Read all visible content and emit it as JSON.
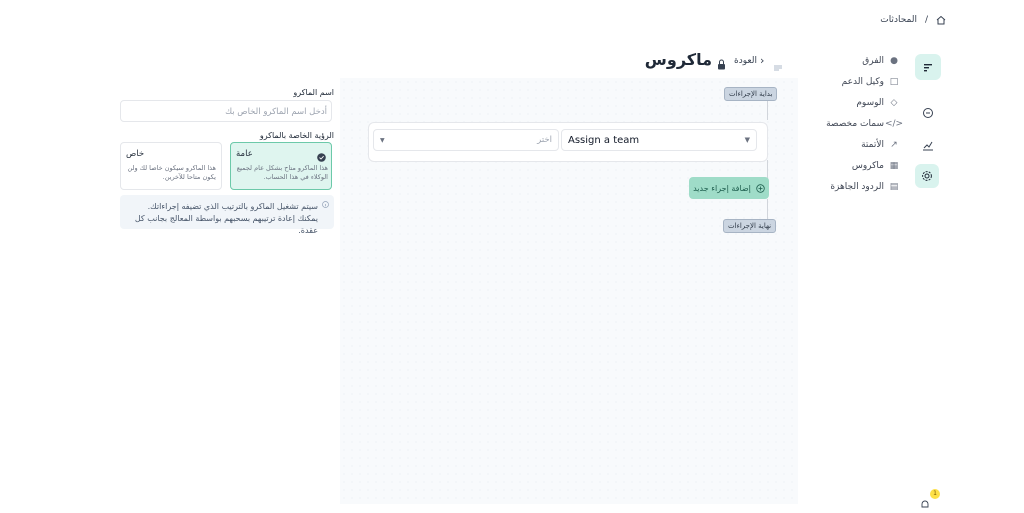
{
  "breadcrumb": {
    "home_icon": "home-icon",
    "separator": "/",
    "current": "المحادثات"
  },
  "header": {
    "title": "ماكروس",
    "back_label": "العودة",
    "lock_icon": "lock-icon",
    "menu_icon": "menu-icon"
  },
  "rail": {
    "items": [
      {
        "icon": "logo-icon",
        "active": false
      },
      {
        "icon": "chat-icon",
        "active": false
      },
      {
        "icon": "reports-icon",
        "active": false
      },
      {
        "icon": "settings-icon",
        "active": true
      }
    ]
  },
  "sidebar": {
    "items": [
      {
        "label": "الفرق",
        "icon": "teams-icon"
      },
      {
        "label": "وكيل الدعم",
        "icon": "agent-icon"
      },
      {
        "label": "الوسوم",
        "icon": "tag-icon"
      },
      {
        "label": "سمات مخصصة",
        "icon": "attributes-icon"
      },
      {
        "label": "الأتمتة",
        "icon": "automation-icon"
      },
      {
        "label": "ماكروس",
        "icon": "macros-icon"
      },
      {
        "label": "الردود الجاهزة",
        "icon": "canned-icon"
      }
    ]
  },
  "canvas": {
    "start_label": "بداية الإجراءات",
    "end_label": "نهاية الإجراءات",
    "action": {
      "type_value": "Assign a team",
      "value_placeholder": "اختر"
    },
    "add_action_label": "إضافة إجراء جديد"
  },
  "form": {
    "name_label": "اسم الماكرو",
    "name_placeholder": "أدخل اسم الماكرو الخاص بك",
    "visibility_label": "الرؤية الخاصة بالماكرو",
    "public": {
      "title": "عامة",
      "desc": "هذا الماكرو متاح بشكل عام لجميع الوكلاء في هذا الحساب."
    },
    "private": {
      "title": "خاص",
      "desc": "هذا الماكرو سيكون خاصا لك ولن يكون متاحا للآخرين."
    },
    "note": "سيتم تشغيل الماكرو بالترتيب الذي تضيفه إجراءاتك. يمكنك إعادة ترتيبهم بسحبهم بواسطة المعالج بجانب كل عقدة."
  },
  "notifications": {
    "count": "1",
    "icon": "bell-icon"
  },
  "colors": {
    "accent": "#9fdcc8",
    "active_bg": "#d9f3ee",
    "canvas_bg": "#f8fafc"
  }
}
